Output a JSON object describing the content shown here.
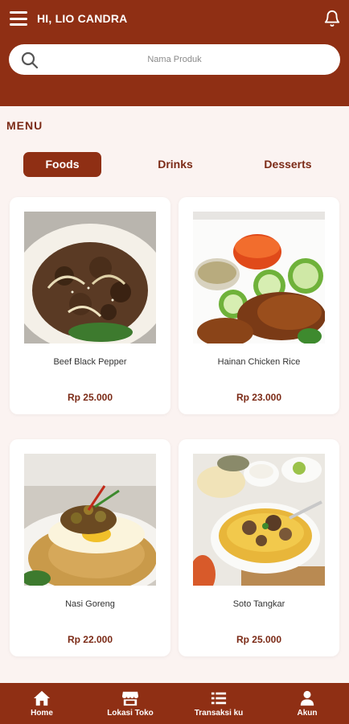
{
  "header": {
    "greeting": "HI, LIO CANDRA",
    "menu_icon": "hamburger-menu-icon",
    "bell_icon": "bell-icon"
  },
  "search": {
    "placeholder": "Nama Produk",
    "icon": "search-icon"
  },
  "section_title": "MENU",
  "tabs": [
    {
      "label": "Foods",
      "active": true
    },
    {
      "label": "Drinks",
      "active": false
    },
    {
      "label": "Desserts",
      "active": false
    }
  ],
  "products": [
    {
      "name": "Beef Black Pepper",
      "price": "Rp 25.000"
    },
    {
      "name": "Hainan Chicken Rice",
      "price": "Rp 23.000"
    },
    {
      "name": "Nasi Goreng",
      "price": "Rp 22.000"
    },
    {
      "name": "Soto Tangkar",
      "price": "Rp 25.000"
    }
  ],
  "bottom_nav": [
    {
      "label": "Home",
      "icon": "home-icon"
    },
    {
      "label": "Lokasi Toko",
      "icon": "store-icon"
    },
    {
      "label": "Transaksi ku",
      "icon": "list-icon"
    },
    {
      "label": "Akun",
      "icon": "user-icon"
    }
  ],
  "colors": {
    "primary": "#8f2f14",
    "background": "#fbf3f1",
    "accent_text": "#7b2a16"
  }
}
